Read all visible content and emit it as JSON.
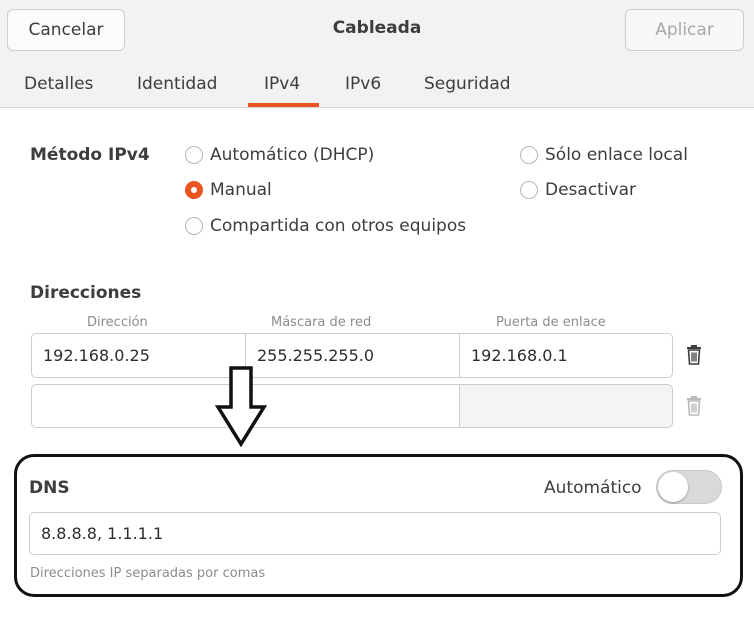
{
  "header": {
    "cancel_label": "Cancelar",
    "title": "Cableada",
    "apply_label": "Aplicar"
  },
  "tabs": [
    {
      "label": "Detalles"
    },
    {
      "label": "Identidad"
    },
    {
      "label": "IPv4",
      "active": true
    },
    {
      "label": "IPv6"
    },
    {
      "label": "Seguridad"
    }
  ],
  "method": {
    "label": "Método IPv4",
    "options": [
      {
        "label": "Automático (DHCP)",
        "checked": false
      },
      {
        "label": "Manual",
        "checked": true
      },
      {
        "label": "Compartida con otros equipos",
        "checked": false
      },
      {
        "label": "Sólo enlace local",
        "checked": false
      },
      {
        "label": "Desactivar",
        "checked": false
      }
    ]
  },
  "addresses": {
    "title": "Direcciones",
    "columns": [
      "Dirección",
      "Máscara de red",
      "Puerta de enlace"
    ],
    "rows": [
      {
        "address": "192.168.0.25",
        "netmask": "255.255.255.0",
        "gateway": "192.168.0.1"
      },
      {
        "address": "",
        "netmask": "",
        "gateway": ""
      }
    ]
  },
  "dns": {
    "title": "DNS",
    "auto_label": "Automático",
    "auto_enabled": false,
    "value": "8.8.8.8, 1.1.1.1",
    "hint": "Direcciones IP separadas por comas"
  },
  "icons": {
    "trash": "trash-icon",
    "arrow": "down-arrow-annotation-icon"
  },
  "colors": {
    "accent": "#e95420",
    "header_bg": "#f2f2f2",
    "disabled_text": "#a8a8a8",
    "annotation": "#111111"
  }
}
